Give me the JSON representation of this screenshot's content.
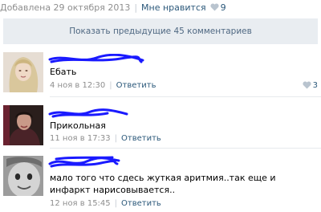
{
  "post_meta": {
    "added": "Добавлена 29 октября 2013",
    "separator": "|",
    "like_label": "Мне нравится",
    "like_count": "9"
  },
  "show_previous": "Показать предыдущие 45 комментариев",
  "comments": [
    {
      "text": "Ебать",
      "time": "4 ноя в 12:30",
      "reply": "Ответить",
      "likes": "3"
    },
    {
      "text": "Прикольная",
      "time": "11 ноя в 17:33",
      "reply": "Ответить"
    },
    {
      "text": "мало того что сдесь жуткая аритмия..так еще и инфаркт нарисовывается..",
      "time": "12 ноя в 15:45",
      "reply": "Ответить"
    }
  ],
  "colors": {
    "link": "#2b587a",
    "muted": "#8e8e8e",
    "bar_bg": "#e9edf1",
    "scribble": "#1a1aff"
  }
}
